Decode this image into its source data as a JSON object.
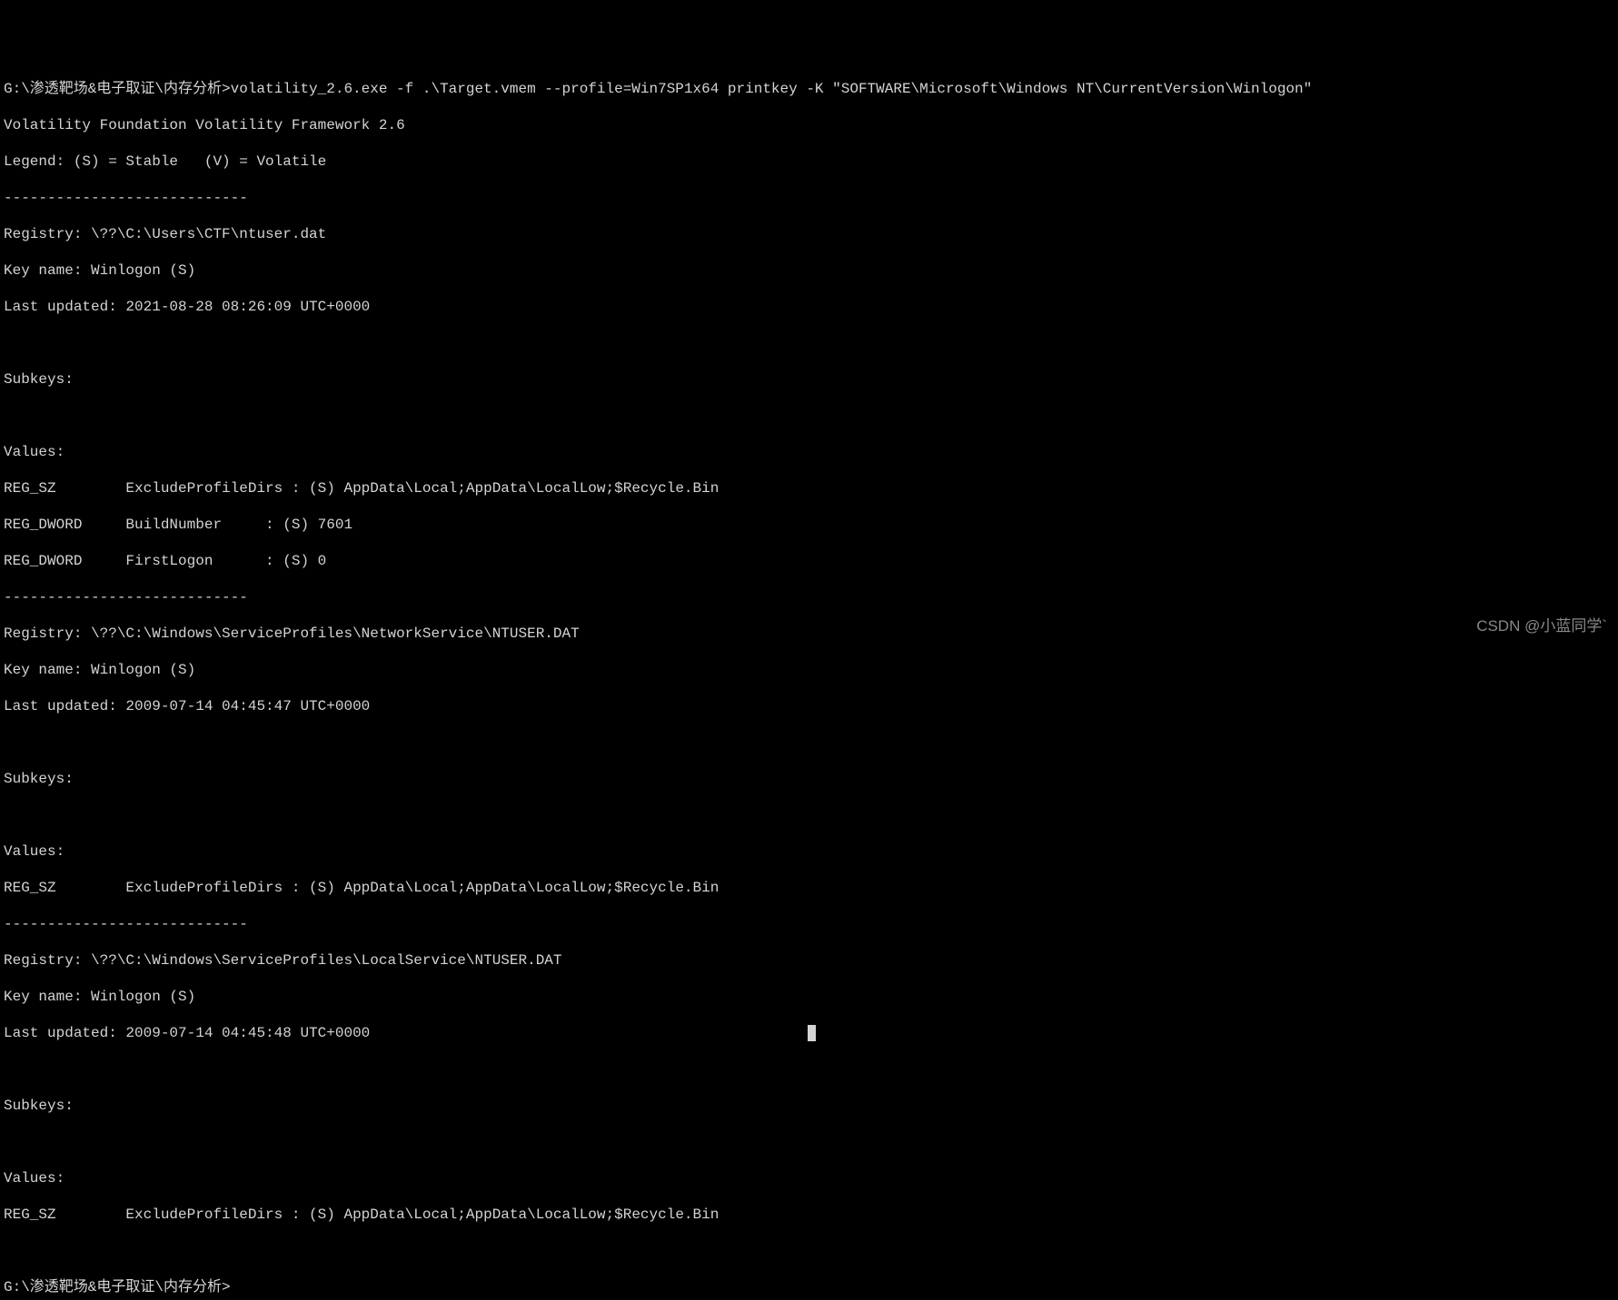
{
  "prompt1": "G:\\渗透靶场&电子取证\\内存分析>",
  "command": "volatility_2.6.exe -f .\\Target.vmem --profile=Win7SP1x64 printkey -K \"SOFTWARE\\Microsoft\\Windows NT\\CurrentVersion\\Winlogon\"",
  "header1": "Volatility Foundation Volatility Framework 2.6",
  "header2": "Legend: (S) = Stable   (V) = Volatile",
  "sep": "----------------------------",
  "reg1_path": "Registry: \\??\\C:\\Users\\CTF\\ntuser.dat",
  "reg1_keyname": "Key name: Winlogon (S)",
  "reg1_updated": "Last updated: 2021-08-28 08:26:09 UTC+0000",
  "subkeys_label": "Subkeys:",
  "values_label": "Values:",
  "reg1_val1": "REG_SZ        ExcludeProfileDirs : (S) AppData\\Local;AppData\\LocalLow;$Recycle.Bin",
  "reg1_val2": "REG_DWORD     BuildNumber     : (S) 7601",
  "reg1_val3": "REG_DWORD     FirstLogon      : (S) 0",
  "reg2_path": "Registry: \\??\\C:\\Windows\\ServiceProfiles\\NetworkService\\NTUSER.DAT",
  "reg2_keyname": "Key name: Winlogon (S)",
  "reg2_updated": "Last updated: 2009-07-14 04:45:47 UTC+0000",
  "reg2_val1": "REG_SZ        ExcludeProfileDirs : (S) AppData\\Local;AppData\\LocalLow;$Recycle.Bin",
  "reg3_path": "Registry: \\??\\C:\\Windows\\ServiceProfiles\\LocalService\\NTUSER.DAT",
  "reg3_keyname": "Key name: Winlogon (S)",
  "reg3_updated": "Last updated: 2009-07-14 04:45:48 UTC+0000",
  "reg3_val1": "REG_SZ        ExcludeProfileDirs : (S) AppData\\Local;AppData\\LocalLow;$Recycle.Bin",
  "prompt2": "G:\\渗透靶场&电子取证\\内存分析>",
  "watermark": "CSDN @小蓝同学`"
}
